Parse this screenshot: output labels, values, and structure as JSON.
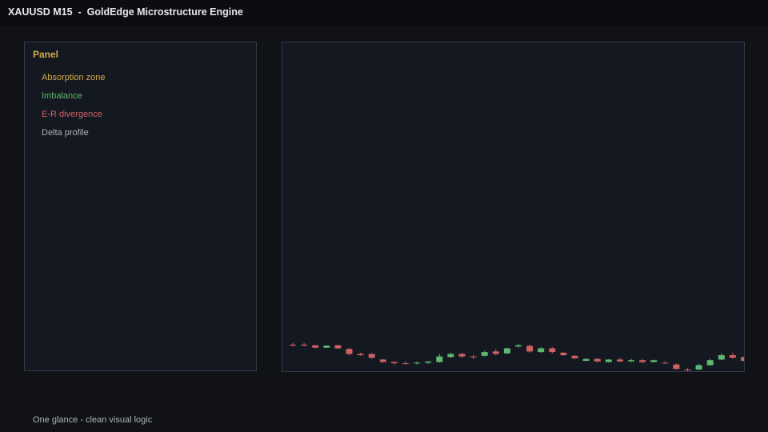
{
  "window": {
    "title": "XAUUSD M15  -  GoldEdge Microstructure Engine"
  },
  "panel": {
    "heading": "Panel",
    "items": [
      {
        "label": "Absorption zone",
        "color": "#d4a94a",
        "icon": "none"
      },
      {
        "label": "Imbalance",
        "color": "#5fb870",
        "icon": "none"
      },
      {
        "label": "E-R divergence",
        "color": "#cf6262",
        "icon": "none"
      },
      {
        "label": "Delta profile",
        "color": "#a9aeb8",
        "icon": "none"
      }
    ]
  },
  "footer": {
    "caption": "One glance - clean visual logic"
  },
  "colors": {
    "background": "#111216",
    "panel_bg": "#141821",
    "border": "#323a48",
    "bull": "#5fb870",
    "bear": "#cf6262",
    "accent": "#d4a94a"
  },
  "chart_data": {
    "type": "candlestick",
    "title": "",
    "xlabel": "",
    "ylabel": "",
    "grid": false,
    "ylim": [
      -22,
      5
    ],
    "candles": [
      {
        "o": 0.0,
        "h": 1.5,
        "l": -1.5,
        "c": 0.0
      },
      {
        "o": 0.0,
        "h": 1.5,
        "l": -1.5,
        "c": 0.0
      },
      {
        "o": -0.5,
        "h": -0.2,
        "l": -3.0,
        "c": -2.5
      },
      {
        "o": -2.5,
        "h": -0.5,
        "l": -2.8,
        "c": -0.8
      },
      {
        "o": -0.5,
        "h": 0.0,
        "l": -3.5,
        "c": -3.0
      },
      {
        "o": -3.5,
        "h": -2.5,
        "l": -8.5,
        "c": -7.5
      },
      {
        "o": -7.5,
        "h": -6.5,
        "l": -9.0,
        "c": -8.5
      },
      {
        "o": -7.5,
        "h": -7.0,
        "l": -11.5,
        "c": -10.5
      },
      {
        "o": -12.0,
        "h": -11.5,
        "l": -14.5,
        "c": -14.0
      },
      {
        "o": -14.0,
        "h": -13.5,
        "l": -16.0,
        "c": -15.0
      },
      {
        "o": -15.0,
        "h": -13.5,
        "l": -16.0,
        "c": -15.0
      },
      {
        "o": -15.0,
        "h": -13.5,
        "l": -16.0,
        "c": -14.5
      },
      {
        "o": -14.5,
        "h": -13.5,
        "l": -15.5,
        "c": -13.5
      },
      {
        "o": -14.0,
        "h": -7.5,
        "l": -14.5,
        "c": -9.5
      },
      {
        "o": -10.0,
        "h": -6.5,
        "l": -10.5,
        "c": -7.5
      },
      {
        "o": -7.5,
        "h": -6.5,
        "l": -10.5,
        "c": -9.5
      },
      {
        "o": -9.5,
        "h": -8.5,
        "l": -11.5,
        "c": -9.5
      },
      {
        "o": -9.0,
        "h": -5.0,
        "l": -9.5,
        "c": -6.0
      },
      {
        "o": -5.5,
        "h": -3.5,
        "l": -8.5,
        "c": -7.5
      },
      {
        "o": -7.0,
        "h": -2.5,
        "l": -7.5,
        "c": -3.0
      },
      {
        "o": -1.5,
        "h": 0.5,
        "l": -2.5,
        "c": -0.5
      },
      {
        "o": -1.0,
        "h": 0.0,
        "l": -6.5,
        "c": -5.5
      },
      {
        "o": -6.0,
        "h": -2.0,
        "l": -6.5,
        "c": -3.0
      },
      {
        "o": -3.0,
        "h": -2.0,
        "l": -7.0,
        "c": -6.0
      },
      {
        "o": -6.5,
        "h": -6.0,
        "l": -9.0,
        "c": -8.5
      },
      {
        "o": -9.0,
        "h": -8.5,
        "l": -11.5,
        "c": -11.0
      },
      {
        "o": -13.0,
        "h": -11.0,
        "l": -13.5,
        "c": -11.5
      },
      {
        "o": -11.5,
        "h": -10.5,
        "l": -14.5,
        "c": -13.5
      },
      {
        "o": -14.0,
        "h": -11.5,
        "l": -14.5,
        "c": -12.0
      },
      {
        "o": -12.0,
        "h": -10.5,
        "l": -14.0,
        "c": -13.5
      },
      {
        "o": -13.5,
        "h": -11.5,
        "l": -14.0,
        "c": -12.5
      },
      {
        "o": -12.5,
        "h": -11.5,
        "l": -15.0,
        "c": -14.0
      },
      {
        "o": -14.0,
        "h": -12.0,
        "l": -14.5,
        "c": -12.5
      },
      {
        "o": -14.5,
        "h": -13.5,
        "l": -15.5,
        "c": -15.0
      },
      {
        "o": -16.0,
        "h": -15.0,
        "l": -20.0,
        "c": -19.5
      },
      {
        "o": -20.0,
        "h": -19.0,
        "l": -21.5,
        "c": -20.5
      },
      {
        "o": -20.0,
        "h": -15.5,
        "l": -20.5,
        "c": -16.5
      },
      {
        "o": -16.5,
        "h": -11.5,
        "l": -17.0,
        "c": -12.5
      },
      {
        "o": -12.0,
        "h": -7.0,
        "l": -12.5,
        "c": -8.5
      },
      {
        "o": -8.5,
        "h": -6.5,
        "l": -11.5,
        "c": -10.5
      },
      {
        "o": -10.0,
        "h": -9.5,
        "l": -14.0,
        "c": -13.0
      },
      {
        "o": -13.5,
        "h": -11.5,
        "l": -14.0,
        "c": -12.0
      }
    ]
  }
}
